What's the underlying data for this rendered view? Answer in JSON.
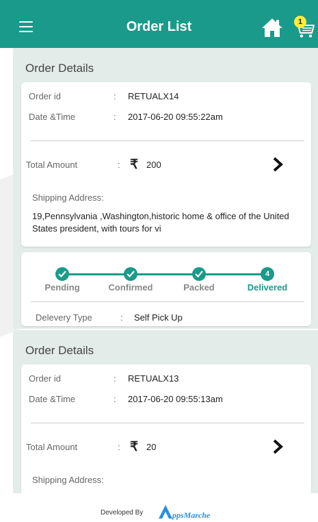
{
  "header": {
    "title": "Order List",
    "cart_count": "1"
  },
  "orders": [
    {
      "section_title": "Order Details",
      "order_id_label": "Order id",
      "order_id": "RETUALX14",
      "date_label": "Date &Time",
      "date": "2017-06-20 09:55:22am",
      "amount_label": "Total Amount",
      "currency": "₹",
      "amount": "200",
      "shipping_label": "Shipping Address:",
      "shipping_address": "19,Pennsylvania ,Washington,historic home & office of the United States president, with tours for vi",
      "statuses": [
        {
          "label": "Pending",
          "marker": "check"
        },
        {
          "label": "Confirmed",
          "marker": "check"
        },
        {
          "label": "Packed",
          "marker": "check"
        },
        {
          "label": "Delivered",
          "marker": "4"
        }
      ],
      "delivery_type_label": "Delevery Type",
      "delivery_type": "Self Pick Up"
    },
    {
      "section_title": "Order Details",
      "order_id_label": "Order id",
      "order_id": "RETUALX13",
      "date_label": "Date &Time",
      "date": "2017-06-20 09:55:13am",
      "amount_label": "Total Amount",
      "currency": "₹",
      "amount": "20",
      "shipping_label": "Shipping Address:"
    }
  ],
  "colon": ":",
  "footer": {
    "developed_by": "Developed By",
    "brand": "ppsMarche"
  },
  "colors": {
    "primary": "#1a9a8a",
    "badge": "#ffeb3b",
    "group_bg": "#e4ecea"
  }
}
